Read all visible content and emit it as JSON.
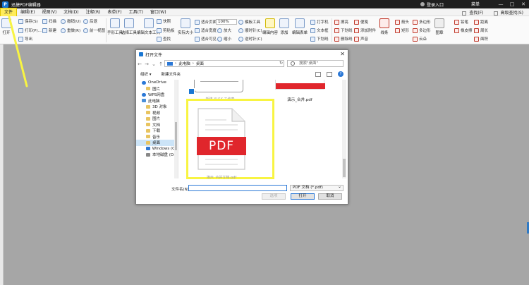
{
  "app": {
    "title": "迅捷PDF编辑器",
    "login_label": "登录入口",
    "menu_label": "菜单",
    "window_controls": [
      "—",
      "□",
      "✕"
    ]
  },
  "menubar": {
    "items": [
      "文件",
      "编辑(E)",
      "视图(V)",
      "文档(D)",
      "注释(R)",
      "表单(F)",
      "工具(T)",
      "窗口(W)"
    ],
    "right": [
      "查找(F)",
      "高级查找(S)"
    ]
  },
  "toolbar": {
    "open": "打开",
    "save": "保存(S)",
    "print": "打印(P)...",
    "export": "导出",
    "scan": "扫描",
    "new": "新建",
    "undo": "撤销(U)",
    "redo": "重做(R)",
    "back": "后退",
    "forward": "前一视图",
    "hand": "手形工具",
    "select": "选择工具",
    "edit_text": "编辑文本工具",
    "snapshot": "快照",
    "clipboard": "剪贴板",
    "find": "查找",
    "actual_size": "实际大小",
    "fit_page": "适合页面",
    "fit_width": "适合宽度",
    "fit_visible": "适合可见",
    "zoom_value": "100%",
    "zoom_in": "放大",
    "zoom_out": "缩小",
    "rotate_tool": "模板工具",
    "rotate_cw": "顺时针(C)",
    "rotate_ccw": "逆时针(C)",
    "edit_content": "编辑内容",
    "add": "添加",
    "edit_form": "编辑表单",
    "typewriter": "打字机",
    "textbox": "文本框",
    "callout": "下划线",
    "highlight": "擦亮",
    "underline": "下划线",
    "strikeout": "删除线",
    "note": "便笺",
    "attach": "添加附件",
    "sound": "声音",
    "line": "线条",
    "arrow": "箭头",
    "rect": "矩形",
    "polygon": "多边形",
    "oval": "椭圆",
    "polyline": "多边形",
    "cloud": "云朵",
    "stamp": "图章",
    "pencil": "铅笔",
    "eraser": "橡皮擦",
    "distance": "距离",
    "perimeter": "周长",
    "area": "面积"
  },
  "dialog": {
    "title": "打开文件",
    "path": [
      "此电脑",
      "桌面"
    ],
    "search_placeholder": "搜索\"桌面\"",
    "organize": "组织 ▾",
    "new_folder": "新建文件夹",
    "nav": [
      {
        "label": "OneDrive",
        "type": "cloud",
        "sub": false
      },
      {
        "label": "图片",
        "type": "fold",
        "sub": true
      },
      {
        "label": "WPS网盘",
        "type": "cloud",
        "sub": false
      },
      {
        "label": "此电脑",
        "type": "pc",
        "sub": false
      },
      {
        "label": "3D 对象",
        "type": "fold",
        "sub": true
      },
      {
        "label": "视频",
        "type": "fold",
        "sub": true
      },
      {
        "label": "图片",
        "type": "fold",
        "sub": true
      },
      {
        "label": "文档",
        "type": "fold",
        "sub": true
      },
      {
        "label": "下载",
        "type": "fold",
        "sub": true
      },
      {
        "label": "音乐",
        "type": "fold",
        "sub": true
      },
      {
        "label": "桌面",
        "type": "fold",
        "sub": true,
        "selected": true
      },
      {
        "label": "Windows (C:)",
        "type": "win",
        "sub": true
      },
      {
        "label": "本地磁盘 (D:)",
        "type": "drive",
        "sub": true
      }
    ],
    "file_a_label": "新建 XLSX 工作表",
    "file_b_label": "演示_合并.pdf",
    "pdf_icon_text": "PDF",
    "pdf_label": "演示_合并文档.pdf",
    "filename_label": "文件名(N):",
    "filename_value": "",
    "filetype": "PDF 文档 (*.pdf)",
    "btn_options": "选项",
    "btn_open": "打开",
    "btn_cancel": "取消"
  },
  "colors": {
    "highlight": "#f8f442",
    "pdf_red": "#e0262c",
    "accent_blue": "#2b78d6"
  }
}
